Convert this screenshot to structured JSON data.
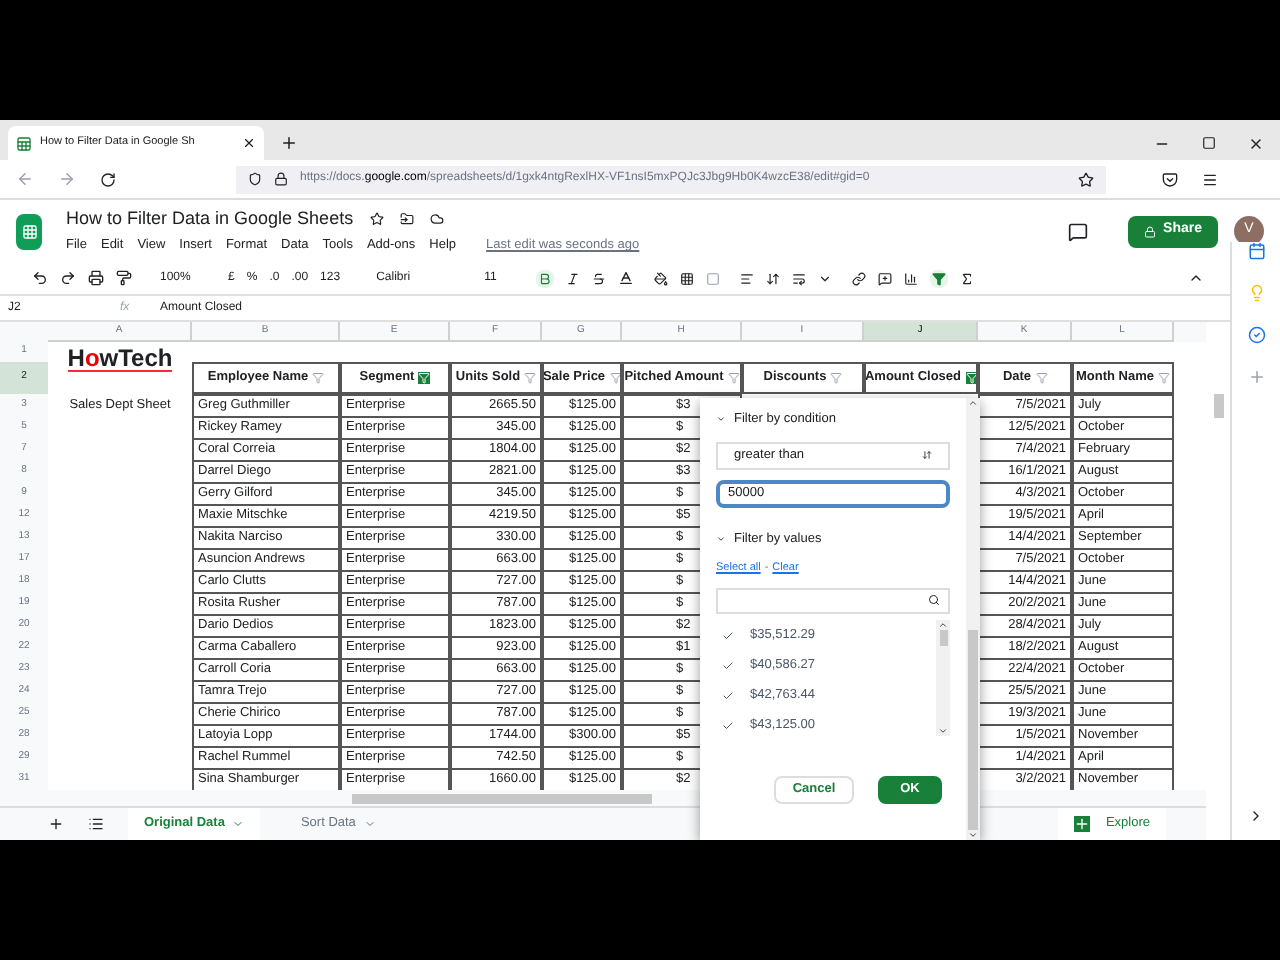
{
  "browser": {
    "tab_title": "How to Filter Data in Google Sh",
    "url_prefix": "https://docs.",
    "url_domain": "google.com",
    "url_rest": "/spreadsheets/d/1gxk4ntgRexlHX-VF1nsI5mxPQJc3Jbg9Hb0K4wzcE38/edit#gid=0"
  },
  "doc": {
    "title": "How to Filter Data in Google Sheets",
    "menus": [
      "File",
      "Edit",
      "View",
      "Insert",
      "Format",
      "Data",
      "Tools",
      "Add-ons",
      "Help"
    ],
    "last_edit": "Last edit was seconds ago",
    "share": "Share",
    "avatar": "V"
  },
  "toolbar": {
    "zoom": "100%",
    "currency": "£",
    "percent": "%",
    "dec_less": ".0",
    "dec_more": ".00",
    "format": "123",
    "font": "Calibri",
    "size": "11",
    "bold": true,
    "filter_on": true
  },
  "formula_bar": {
    "cell": "J2",
    "fx": "fx",
    "value": "Amount Closed"
  },
  "columns": [
    {
      "letter": "A",
      "selected": false
    },
    {
      "letter": "B",
      "selected": false
    },
    {
      "letter": "E",
      "selected": false
    },
    {
      "letter": "F",
      "selected": false
    },
    {
      "letter": "G",
      "selected": false
    },
    {
      "letter": "H",
      "selected": false
    },
    {
      "letter": "I",
      "selected": false
    },
    {
      "letter": "J",
      "selected": true
    },
    {
      "letter": "K",
      "selected": false
    },
    {
      "letter": "L",
      "selected": false
    }
  ],
  "top_rows": [
    "1",
    "2"
  ],
  "logo": {
    "text_before": "H",
    "text_o": "o",
    "text_after": "wTech"
  },
  "headers": [
    {
      "label": "Employee Name",
      "filtered": false
    },
    {
      "label": "Segment",
      "filtered": true
    },
    {
      "label": "Units Sold",
      "filtered": false
    },
    {
      "label": "Sale Price",
      "filtered": false
    },
    {
      "label": "Pitched Amount",
      "filtered": false
    },
    {
      "label": "Discounts",
      "filtered": false
    },
    {
      "label": "Amount Closed",
      "filtered": true
    },
    {
      "label": "Date",
      "filtered": false
    },
    {
      "label": "Month Name",
      "filtered": false
    }
  ],
  "rows": [
    {
      "num": "3",
      "a": "Sales Dept Sheet",
      "name": "Greg Guthmiller",
      "segment": "Enterprise",
      "units": "2665.50",
      "price": "$125.00",
      "pitched": "$3",
      "date": "7/5/2021",
      "month": "July"
    },
    {
      "num": "5",
      "name": "Rickey Ramey",
      "segment": "Enterprise",
      "units": "345.00",
      "price": "$125.00",
      "pitched": "$",
      "date": "12/5/2021",
      "month": "October"
    },
    {
      "num": "7",
      "name": "Coral Correia",
      "segment": "Enterprise",
      "units": "1804.00",
      "price": "$125.00",
      "pitched": "$2",
      "date": "7/4/2021",
      "month": "February"
    },
    {
      "num": "8",
      "name": "Darrel Diego",
      "segment": "Enterprise",
      "units": "2821.00",
      "price": "$125.00",
      "pitched": "$3",
      "date": "16/1/2021",
      "month": "August"
    },
    {
      "num": "9",
      "name": "Gerry Gilford",
      "segment": "Enterprise",
      "units": "345.00",
      "price": "$125.00",
      "pitched": "$",
      "date": "4/3/2021",
      "month": "October"
    },
    {
      "num": "12",
      "name": "Maxie Mitschke",
      "segment": "Enterprise",
      "units": "4219.50",
      "price": "$125.00",
      "pitched": "$5",
      "date": "19/5/2021",
      "month": "April"
    },
    {
      "num": "13",
      "name": "Nakita Narciso",
      "segment": "Enterprise",
      "units": "330.00",
      "price": "$125.00",
      "pitched": "$",
      "date": "14/4/2021",
      "month": "September"
    },
    {
      "num": "17",
      "name": "Asuncion Andrews",
      "segment": "Enterprise",
      "units": "663.00",
      "price": "$125.00",
      "pitched": "$",
      "date": "7/5/2021",
      "month": "October"
    },
    {
      "num": "18",
      "name": "Carlo Clutts",
      "segment": "Enterprise",
      "units": "727.00",
      "price": "$125.00",
      "pitched": "$",
      "date": "14/4/2021",
      "month": "June"
    },
    {
      "num": "19",
      "name": "Rosita Rusher",
      "segment": "Enterprise",
      "units": "787.00",
      "price": "$125.00",
      "pitched": "$",
      "date": "20/2/2021",
      "month": "June"
    },
    {
      "num": "20",
      "name": "Dario Dedios",
      "segment": "Enterprise",
      "units": "1823.00",
      "price": "$125.00",
      "pitched": "$2",
      "date": "28/4/2021",
      "month": "July"
    },
    {
      "num": "22",
      "name": "Carma Caballero",
      "segment": "Enterprise",
      "units": "923.00",
      "price": "$125.00",
      "pitched": "$1",
      "date": "18/2/2021",
      "month": "August"
    },
    {
      "num": "23",
      "name": "Carroll Coria",
      "segment": "Enterprise",
      "units": "663.00",
      "price": "$125.00",
      "pitched": "$",
      "date": "22/4/2021",
      "month": "October"
    },
    {
      "num": "24",
      "name": "Tamra Trejo",
      "segment": "Enterprise",
      "units": "727.00",
      "price": "$125.00",
      "pitched": "$",
      "date": "25/5/2021",
      "month": "June"
    },
    {
      "num": "25",
      "name": "Cherie Chirico",
      "segment": "Enterprise",
      "units": "787.00",
      "price": "$125.00",
      "pitched": "$",
      "date": "19/3/2021",
      "month": "June"
    },
    {
      "num": "28",
      "name": "Latoyia Lopp",
      "segment": "Enterprise",
      "units": "1744.00",
      "price": "$300.00",
      "pitched": "$5",
      "date": "1/5/2021",
      "month": "November"
    },
    {
      "num": "29",
      "name": "Rachel Rummel",
      "segment": "Enterprise",
      "units": "742.50",
      "price": "$125.00",
      "pitched": "$",
      "date": "1/4/2021",
      "month": "April"
    },
    {
      "num": "31",
      "name": "Sina Shamburger",
      "segment": "Enterprise",
      "units": "1660.00",
      "price": "$125.00",
      "pitched": "$2",
      "date": "3/2/2021",
      "month": "November"
    }
  ],
  "filter_menu": {
    "condition_header": "Filter by condition",
    "condition_expanded": true,
    "condition": "greater than",
    "value": "50000",
    "values_header": "Filter by values",
    "values_expanded": true,
    "select_all": "Select all",
    "separator": "-",
    "clear": "Clear",
    "values": [
      {
        "label": "$35,512.29",
        "checked": true
      },
      {
        "label": "$40,586.27",
        "checked": true
      },
      {
        "label": "$42,763.44",
        "checked": true
      },
      {
        "label": "$43,125.00",
        "checked": true
      }
    ],
    "cancel": "Cancel",
    "ok": "OK"
  },
  "sheet_tabs": [
    {
      "label": "Original Data",
      "selected": true
    },
    {
      "label": "Sort Data",
      "selected": false
    }
  ],
  "explore": "Explore"
}
